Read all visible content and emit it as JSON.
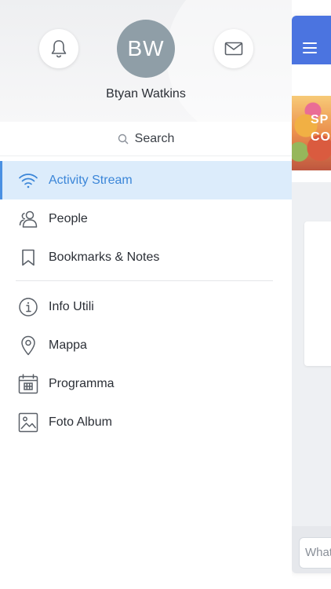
{
  "user": {
    "initials": "BW",
    "name": "Btyan Watkins"
  },
  "search": {
    "label": "Search"
  },
  "nav_primary": [
    {
      "label": "Activity Stream",
      "icon": "wifi-icon",
      "active": true
    },
    {
      "label": "People",
      "icon": "people-icon",
      "active": false
    },
    {
      "label": "Bookmarks & Notes",
      "icon": "bookmark-icon",
      "active": false
    }
  ],
  "nav_secondary": [
    {
      "label": "Info Utili",
      "icon": "info-icon"
    },
    {
      "label": "Mappa",
      "icon": "map-pin-icon"
    },
    {
      "label": "Programma",
      "icon": "calendar-icon"
    },
    {
      "label": "Foto Album",
      "icon": "photo-icon"
    }
  ],
  "background_app": {
    "banner_line1": "SP",
    "banner_line2": "CO",
    "compose_placeholder": "What"
  },
  "colors": {
    "accent": "#3b86d8",
    "active_bg": "#dcecfb",
    "topbar": "#4b74e0",
    "avatar": "#8f9ea7"
  }
}
